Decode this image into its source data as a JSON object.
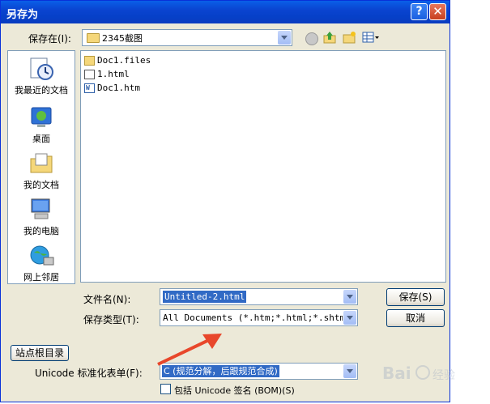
{
  "window": {
    "title": "另存为",
    "help": "?",
    "close": "✕"
  },
  "save_in": {
    "label": "保存在(I):",
    "value": "2345截图"
  },
  "places": [
    {
      "label": "我最近的文档"
    },
    {
      "label": "桌面"
    },
    {
      "label": "我的文档"
    },
    {
      "label": "我的电脑"
    },
    {
      "label": "网上邻居"
    }
  ],
  "files": [
    {
      "name": "Doc1.files",
      "icon": "folder-icon"
    },
    {
      "name": "1.html",
      "icon": "html-file-icon"
    },
    {
      "name": "Doc1.htm",
      "icon": "word-file-icon"
    }
  ],
  "filename": {
    "label": "文件名(N):",
    "value": "Untitled-2.html"
  },
  "filetype": {
    "label": "保存类型(T):",
    "value": "All Documents (*.htm;*.html;*.shtm;*."
  },
  "buttons": {
    "save": "保存(S)",
    "cancel": "取消",
    "site_root": "站点根目录"
  },
  "unicode_norm": {
    "label": "Unicode 标准化表单(F):",
    "value": "C (规范分解，后跟规范合成)"
  },
  "bom": {
    "label": "包括 Unicode 签名 (BOM)(S)",
    "checked": false
  },
  "colors": {
    "title_bar": "#0a50dc",
    "dialog_bg": "#ece9d8",
    "selection": "#316ac5",
    "annotation_arrow": "#e8472b"
  }
}
